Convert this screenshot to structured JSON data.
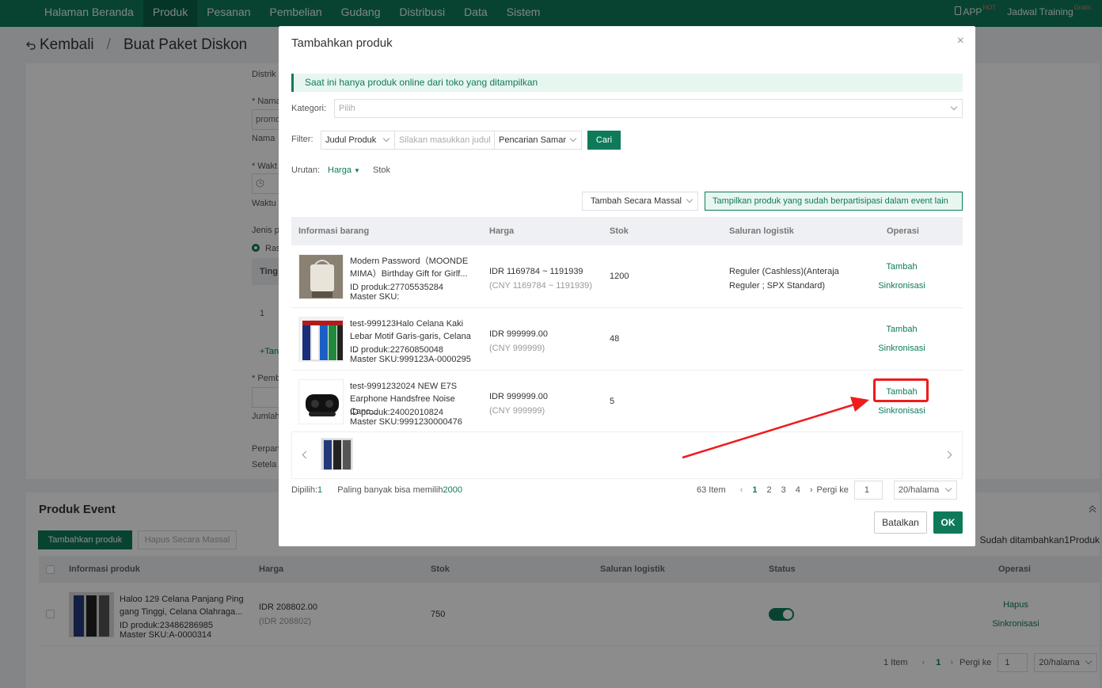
{
  "nav": {
    "items": [
      "Halaman Beranda",
      "Produk",
      "Pesanan",
      "Pembelian",
      "Gudang",
      "Distribusi",
      "Data",
      "Sistem"
    ],
    "active": "Produk",
    "app_label": "APP",
    "app_badge": "HOT",
    "training_label": "Jadwal Training",
    "training_badge": "Gratis"
  },
  "page": {
    "back_label": "Kembali",
    "separator": "/",
    "title": "Buat Paket Diskon"
  },
  "bg_form": {
    "labels": [
      "Distrik",
      "* Nama",
      "promo",
      "Nama",
      "* Wakt",
      "Waktu",
      "Jenis p",
      "Ras",
      "Ting",
      "1",
      "+Tan",
      "* Pemb",
      "Jumlah",
      "Perpan",
      "Setela"
    ]
  },
  "event": {
    "title": "Produk Event",
    "add_button": "Tambahkan produk",
    "bulk_delete_button": "Hapus Secara Massal",
    "added_note": "Sudah ditambahkan1Produk",
    "columns": [
      "Informasi produk",
      "Harga",
      "Stok",
      "Saluran logistik",
      "Status",
      "Operasi"
    ],
    "row": {
      "name": "Haloo 129 Celana Panjang Ping gang Tinggi, Celana Olahraga...",
      "id": "ID produk:23486286985",
      "sku": "Master SKU:A-0000314",
      "price": "IDR 208802.00",
      "price_sub": "(IDR 208802)",
      "stock": "750",
      "op_delete": "Hapus",
      "op_sync": "Sinkronisasi"
    },
    "pager": {
      "total": "1 Item",
      "page": "1",
      "goto_label": "Pergi ke",
      "goto_value": "1",
      "page_size": "20/halama"
    }
  },
  "modal": {
    "title": "Tambahkan produk",
    "notice": "Saat ini hanya produk online dari toko yang ditampilkan",
    "category_label": "Kategori:",
    "category_placeholder": "Pilih",
    "filter_label": "Filter:",
    "filter_field": "Judul Produk",
    "filter_placeholder": "Silakan masukkan judul",
    "filter_mode": "Pencarian Samar",
    "search_button": "Cari",
    "sort_label": "Urutan:",
    "sort_price": "Harga",
    "sort_stock": "Stok",
    "bulk_add": "Tambah Secara Massal",
    "show_other": "Tampilkan produk yang sudah berpartisipasi dalam event lain",
    "columns": [
      "Informasi barang",
      "Harga",
      "Stok",
      "Saluran logistik",
      "Operasi"
    ],
    "products": [
      {
        "name": "Modern Password（MOONDE MIMA）Birthday Gift for Girlf...",
        "id": "ID produk:27705535284",
        "sku": "Master SKU:",
        "price": "IDR 1169784 ~ 1191939",
        "price_sub": "(CNY 1169784 ~ 1191939)",
        "stock": "1200",
        "logistics": "Reguler (Cashless)(Anteraja Reguler ; SPX Standard)",
        "op_add": "Tambah",
        "op_sync": "Sinkronisasi"
      },
      {
        "name": "test-999123Halo Celana Kaki Lebar Motif Garis-garis, Celana ...",
        "id": "ID produk:22760850048",
        "sku": "Master SKU:999123A-0000295",
        "price": "IDR 999999.00",
        "price_sub": "(CNY 999999)",
        "stock": "48",
        "logistics": "",
        "op_add": "Tambah",
        "op_sync": "Sinkronisasi"
      },
      {
        "name": "test-9991232024 NEW E7S Earphone Handsfree Noise Canc...",
        "id": "ID produk:24002010824",
        "sku": "Master SKU:9991230000476",
        "price": "IDR 999999.00",
        "price_sub": "(CNY 999999)",
        "stock": "5",
        "logistics": "",
        "op_add": "Tambah",
        "op_sync": "Sinkronisasi"
      }
    ],
    "selected_label": "Dipilih:",
    "selected_count": "1",
    "max_label": "Paling banyak bisa memilih",
    "max_value": "2000",
    "pager": {
      "total": "63 Item",
      "pages": [
        "1",
        "2",
        "3",
        "4"
      ],
      "goto_label": "Pergi ke",
      "goto_value": "1",
      "page_size": "20/halama"
    },
    "cancel_button": "Batalkan",
    "ok_button": "OK"
  },
  "colors": {
    "brand": "#0f7a5a",
    "highlight": "#ee1c1c"
  }
}
